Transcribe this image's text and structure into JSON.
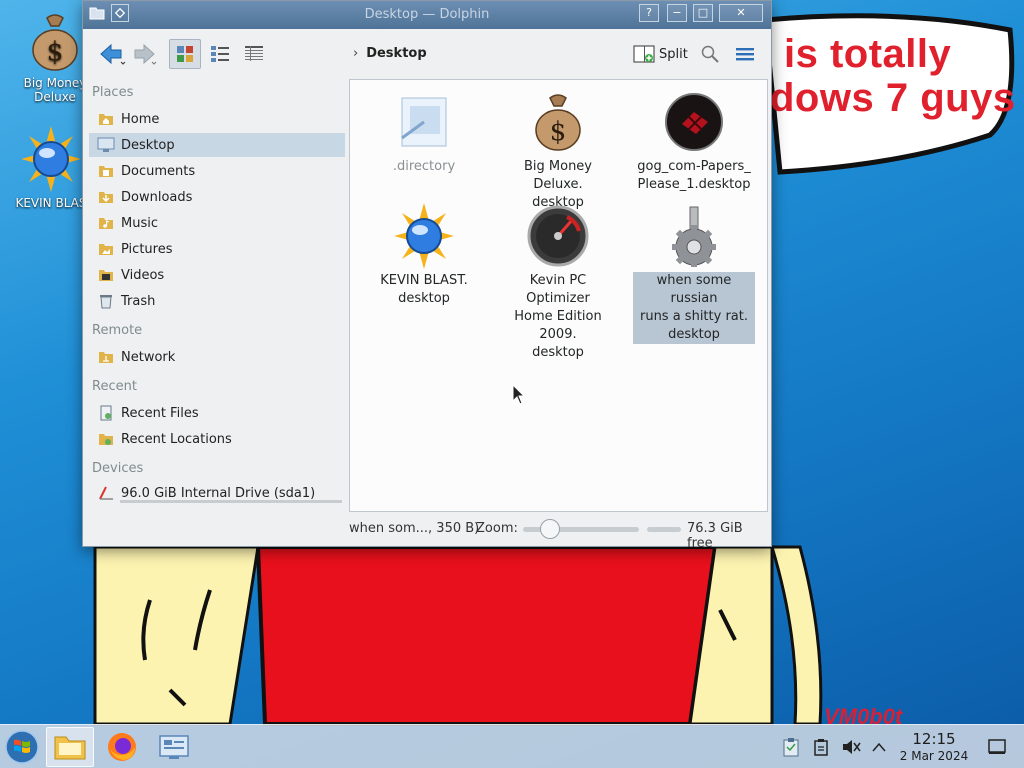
{
  "desktop": {
    "caption_line1": "is totally",
    "caption_line2": "dows 7 guys",
    "watermark": "VM0b0t",
    "icons": [
      {
        "label": "Big Money\nDeluxe"
      },
      {
        "label": "KEVIN BLAS"
      }
    ]
  },
  "window": {
    "title": "Desktop — Dolphin",
    "controls": {
      "help": "?",
      "minimize": "−",
      "maximize": "□",
      "close": "✕"
    }
  },
  "toolbar": {
    "breadcrumb": "Desktop",
    "split_label": "Split"
  },
  "sidebar": {
    "sections": [
      {
        "heading": "Places",
        "items": [
          {
            "label": "Home",
            "icon": "home-folder-icon"
          },
          {
            "label": "Desktop",
            "icon": "desktop-icon",
            "selected": true
          },
          {
            "label": "Documents",
            "icon": "documents-folder-icon"
          },
          {
            "label": "Downloads",
            "icon": "downloads-folder-icon"
          },
          {
            "label": "Music",
            "icon": "music-folder-icon"
          },
          {
            "label": "Pictures",
            "icon": "pictures-folder-icon"
          },
          {
            "label": "Videos",
            "icon": "videos-folder-icon"
          },
          {
            "label": "Trash",
            "icon": "trash-icon"
          }
        ]
      },
      {
        "heading": "Remote",
        "items": [
          {
            "label": "Network",
            "icon": "network-folder-icon"
          }
        ]
      },
      {
        "heading": "Recent",
        "items": [
          {
            "label": "Recent Files",
            "icon": "recent-files-icon"
          },
          {
            "label": "Recent Locations",
            "icon": "recent-locations-icon"
          }
        ]
      },
      {
        "heading": "Devices",
        "items": [
          {
            "label": "96.0 GiB Internal Drive (sda1)",
            "icon": "drive-icon"
          }
        ]
      }
    ]
  },
  "files": [
    {
      "name": ".directory",
      "icon": "directory-file-icon",
      "hidden": true
    },
    {
      "name": "Big Money Deluxe.\ndesktop",
      "icon": "money-bag-icon"
    },
    {
      "name": "gog_com-Papers_\nPlease_1.desktop",
      "icon": "papers-please-icon"
    },
    {
      "name": "KEVIN BLAST.\ndesktop",
      "icon": "kevin-blast-icon"
    },
    {
      "name": "Kevin PC Optimizer\nHome Edition 2009.\ndesktop",
      "icon": "gauge-icon"
    },
    {
      "name": "when some russian\nruns a shitty rat.\ndesktop",
      "icon": "gear-icon",
      "selected": true
    }
  ],
  "statusbar": {
    "selection": "when som..., 350 B)",
    "zoom_label": "Zoom:",
    "zoom_level": 0.18,
    "free_space": "76.3 GiB free"
  },
  "taskbar": {
    "time": "12:15",
    "date": "2 Mar 2024"
  },
  "colors": {
    "accent_selection": "#c8d7e4",
    "titlebar": "#5a7ea3",
    "caption_red": "#e0202c"
  }
}
